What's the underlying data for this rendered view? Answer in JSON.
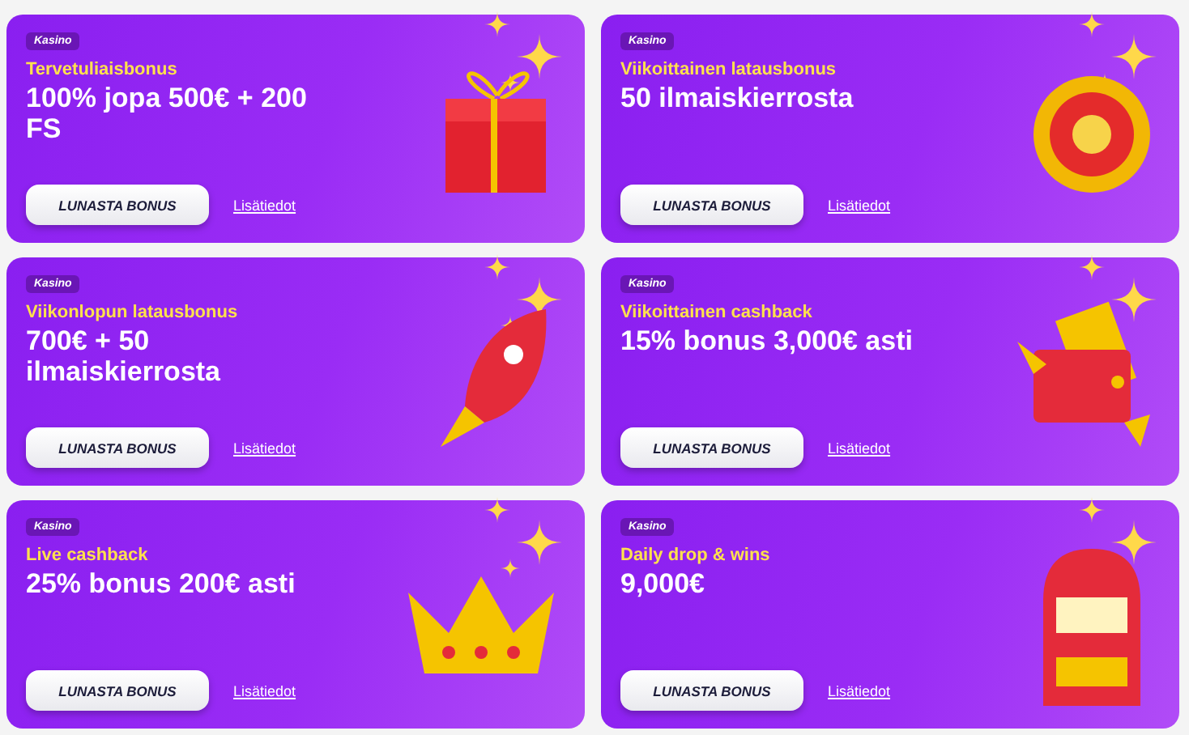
{
  "cards": [
    {
      "badge": "Kasino",
      "subtitle": "Tervetuliaisbonus",
      "title": "100% jopa 500€ + 200 FS",
      "button": "LUNASTA BONUS",
      "link": "Lisätiedot",
      "kind": "gift"
    },
    {
      "badge": "Kasino",
      "subtitle": "Viikoittainen latausbonus",
      "title": "50 ilmaiskierrosta",
      "button": "LUNASTA BONUS",
      "link": "Lisätiedot",
      "kind": "coin"
    },
    {
      "badge": "Kasino",
      "subtitle": "Viikonlopun latausbonus",
      "title": "700€ + 50 ilmaiskierrosta",
      "button": "LUNASTA BONUS",
      "link": "Lisätiedot",
      "kind": "rocket"
    },
    {
      "badge": "Kasino",
      "subtitle": "Viikoittainen cashback",
      "title": "15% bonus 3,000€ asti",
      "button": "LUNASTA BONUS",
      "link": "Lisätiedot",
      "kind": "wallet"
    },
    {
      "badge": "Kasino",
      "subtitle": "Live cashback",
      "title": "25% bonus 200€ asti",
      "button": "LUNASTA BONUS",
      "link": "Lisätiedot",
      "kind": "crown"
    },
    {
      "badge": "Kasino",
      "subtitle": "Daily drop & wins",
      "title": "9,000€",
      "button": "LUNASTA BONUS",
      "link": "Lisätiedot",
      "kind": "slot"
    }
  ]
}
